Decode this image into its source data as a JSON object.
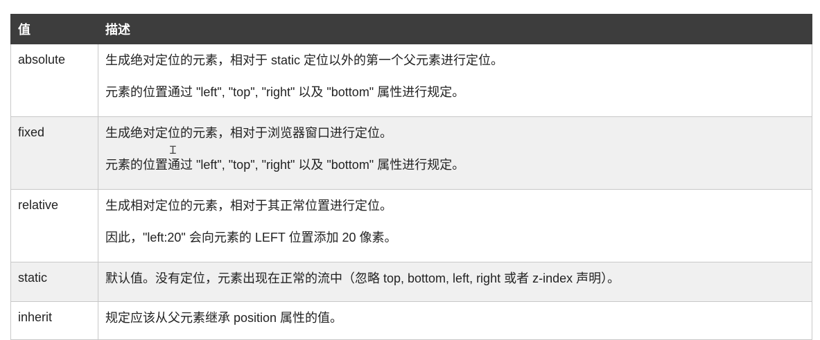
{
  "table": {
    "headers": {
      "value": "值",
      "description": "描述"
    },
    "rows": [
      {
        "value": "absolute",
        "lines": [
          "生成绝对定位的元素，相对于 static 定位以外的第一个父元素进行定位。",
          "元素的位置通过 \"left\", \"top\", \"right\" 以及 \"bottom\" 属性进行规定。"
        ]
      },
      {
        "value": "fixed",
        "lines": [
          "生成绝对定位的元素，相对于浏览器窗口进行定位。",
          "元素的位置通过 \"left\", \"top\", \"right\" 以及 \"bottom\" 属性进行规定。"
        ]
      },
      {
        "value": "relative",
        "lines": [
          "生成相对定位的元素，相对于其正常位置进行定位。",
          "因此，\"left:20\" 会向元素的 LEFT 位置添加 20 像素。"
        ]
      },
      {
        "value": "static",
        "lines": [
          "默认值。没有定位，元素出现在正常的流中（忽略 top, bottom, left, right 或者 z-index 声明）。"
        ]
      },
      {
        "value": "inherit",
        "lines": [
          "规定应该从父元素继承 position 属性的值。"
        ]
      }
    ]
  },
  "cursor": {
    "glyph": "Ɪ",
    "icon": "text-cursor-icon"
  }
}
